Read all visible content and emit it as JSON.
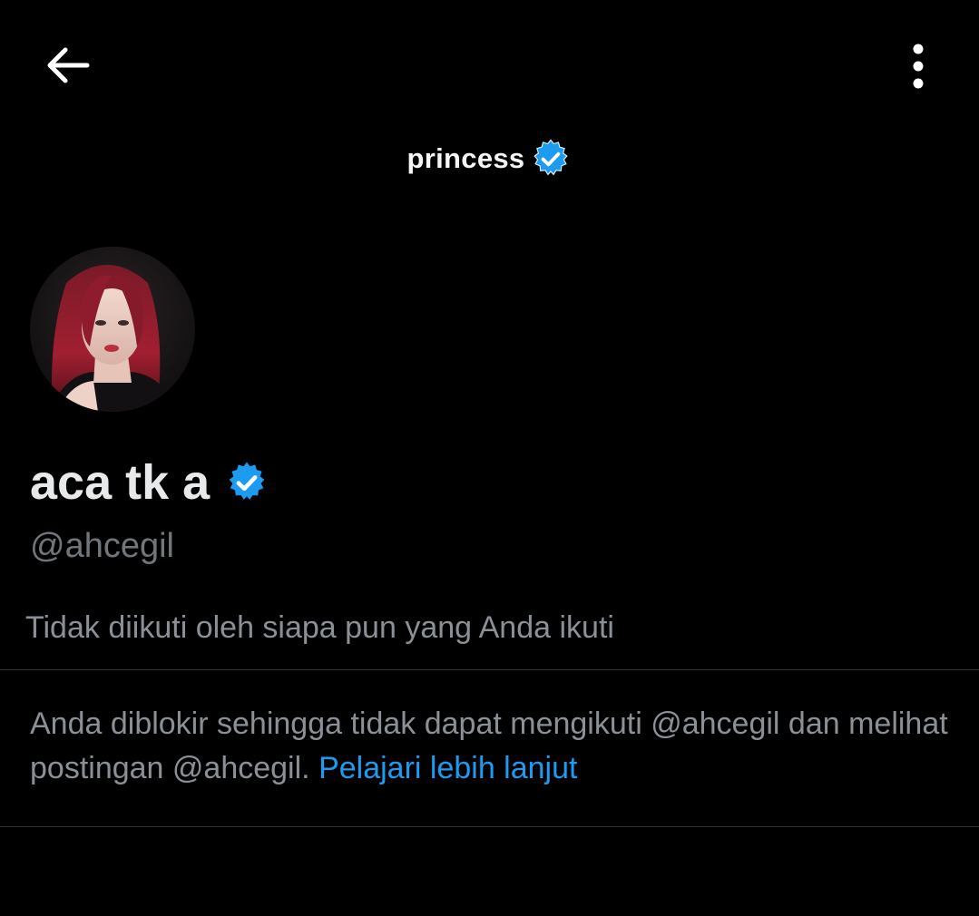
{
  "header": {
    "banner_title": "princess"
  },
  "profile": {
    "display_name": "aca tk a",
    "handle": "@ahcegil",
    "followed_by_text": "Tidak diikuti oleh siapa pun yang Anda ikuti"
  },
  "blocked": {
    "message": "Anda diblokir sehingga tidak dapat mengikuti @ahcegil dan melihat postingan @ahcegil.",
    "learn_more_label": "Pelajari lebih lanjut"
  },
  "colors": {
    "background": "#000000",
    "primary_text": "#e7e9ea",
    "secondary_text": "#71767b",
    "link": "#1d9bf0",
    "verified_badge": "#1d9bf0",
    "divider": "#2f3336"
  },
  "icons": {
    "back": "arrow-left-icon",
    "more": "more-vertical-icon",
    "verified": "verified-badge-icon"
  }
}
